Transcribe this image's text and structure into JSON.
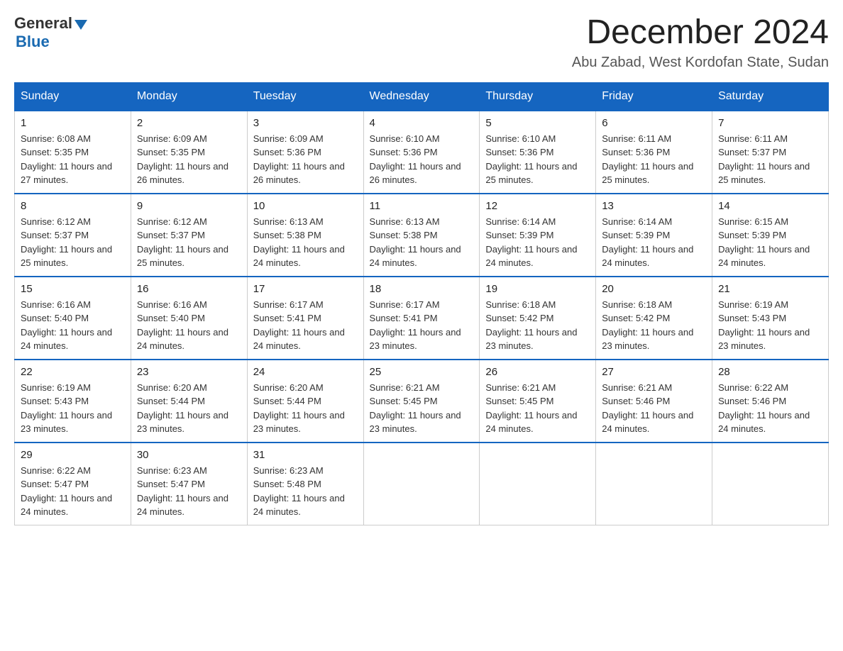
{
  "header": {
    "logo_general": "General",
    "logo_blue": "Blue",
    "month_title": "December 2024",
    "location": "Abu Zabad, West Kordofan State, Sudan"
  },
  "weekdays": [
    "Sunday",
    "Monday",
    "Tuesday",
    "Wednesday",
    "Thursday",
    "Friday",
    "Saturday"
  ],
  "weeks": [
    [
      {
        "day": "1",
        "sunrise": "6:08 AM",
        "sunset": "5:35 PM",
        "daylight": "11 hours and 27 minutes."
      },
      {
        "day": "2",
        "sunrise": "6:09 AM",
        "sunset": "5:35 PM",
        "daylight": "11 hours and 26 minutes."
      },
      {
        "day": "3",
        "sunrise": "6:09 AM",
        "sunset": "5:36 PM",
        "daylight": "11 hours and 26 minutes."
      },
      {
        "day": "4",
        "sunrise": "6:10 AM",
        "sunset": "5:36 PM",
        "daylight": "11 hours and 26 minutes."
      },
      {
        "day": "5",
        "sunrise": "6:10 AM",
        "sunset": "5:36 PM",
        "daylight": "11 hours and 25 minutes."
      },
      {
        "day": "6",
        "sunrise": "6:11 AM",
        "sunset": "5:36 PM",
        "daylight": "11 hours and 25 minutes."
      },
      {
        "day": "7",
        "sunrise": "6:11 AM",
        "sunset": "5:37 PM",
        "daylight": "11 hours and 25 minutes."
      }
    ],
    [
      {
        "day": "8",
        "sunrise": "6:12 AM",
        "sunset": "5:37 PM",
        "daylight": "11 hours and 25 minutes."
      },
      {
        "day": "9",
        "sunrise": "6:12 AM",
        "sunset": "5:37 PM",
        "daylight": "11 hours and 25 minutes."
      },
      {
        "day": "10",
        "sunrise": "6:13 AM",
        "sunset": "5:38 PM",
        "daylight": "11 hours and 24 minutes."
      },
      {
        "day": "11",
        "sunrise": "6:13 AM",
        "sunset": "5:38 PM",
        "daylight": "11 hours and 24 minutes."
      },
      {
        "day": "12",
        "sunrise": "6:14 AM",
        "sunset": "5:39 PM",
        "daylight": "11 hours and 24 minutes."
      },
      {
        "day": "13",
        "sunrise": "6:14 AM",
        "sunset": "5:39 PM",
        "daylight": "11 hours and 24 minutes."
      },
      {
        "day": "14",
        "sunrise": "6:15 AM",
        "sunset": "5:39 PM",
        "daylight": "11 hours and 24 minutes."
      }
    ],
    [
      {
        "day": "15",
        "sunrise": "6:16 AM",
        "sunset": "5:40 PM",
        "daylight": "11 hours and 24 minutes."
      },
      {
        "day": "16",
        "sunrise": "6:16 AM",
        "sunset": "5:40 PM",
        "daylight": "11 hours and 24 minutes."
      },
      {
        "day": "17",
        "sunrise": "6:17 AM",
        "sunset": "5:41 PM",
        "daylight": "11 hours and 24 minutes."
      },
      {
        "day": "18",
        "sunrise": "6:17 AM",
        "sunset": "5:41 PM",
        "daylight": "11 hours and 23 minutes."
      },
      {
        "day": "19",
        "sunrise": "6:18 AM",
        "sunset": "5:42 PM",
        "daylight": "11 hours and 23 minutes."
      },
      {
        "day": "20",
        "sunrise": "6:18 AM",
        "sunset": "5:42 PM",
        "daylight": "11 hours and 23 minutes."
      },
      {
        "day": "21",
        "sunrise": "6:19 AM",
        "sunset": "5:43 PM",
        "daylight": "11 hours and 23 minutes."
      }
    ],
    [
      {
        "day": "22",
        "sunrise": "6:19 AM",
        "sunset": "5:43 PM",
        "daylight": "11 hours and 23 minutes."
      },
      {
        "day": "23",
        "sunrise": "6:20 AM",
        "sunset": "5:44 PM",
        "daylight": "11 hours and 23 minutes."
      },
      {
        "day": "24",
        "sunrise": "6:20 AM",
        "sunset": "5:44 PM",
        "daylight": "11 hours and 23 minutes."
      },
      {
        "day": "25",
        "sunrise": "6:21 AM",
        "sunset": "5:45 PM",
        "daylight": "11 hours and 23 minutes."
      },
      {
        "day": "26",
        "sunrise": "6:21 AM",
        "sunset": "5:45 PM",
        "daylight": "11 hours and 24 minutes."
      },
      {
        "day": "27",
        "sunrise": "6:21 AM",
        "sunset": "5:46 PM",
        "daylight": "11 hours and 24 minutes."
      },
      {
        "day": "28",
        "sunrise": "6:22 AM",
        "sunset": "5:46 PM",
        "daylight": "11 hours and 24 minutes."
      }
    ],
    [
      {
        "day": "29",
        "sunrise": "6:22 AM",
        "sunset": "5:47 PM",
        "daylight": "11 hours and 24 minutes."
      },
      {
        "day": "30",
        "sunrise": "6:23 AM",
        "sunset": "5:47 PM",
        "daylight": "11 hours and 24 minutes."
      },
      {
        "day": "31",
        "sunrise": "6:23 AM",
        "sunset": "5:48 PM",
        "daylight": "11 hours and 24 minutes."
      },
      null,
      null,
      null,
      null
    ]
  ]
}
